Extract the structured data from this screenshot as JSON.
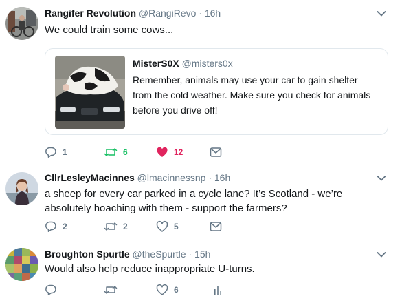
{
  "tweets": [
    {
      "name": "Rangifer Revolution",
      "handle": "@RangiRevo",
      "dot": "·",
      "time": "16h",
      "text": "We could train some cows...",
      "quoted": {
        "name": "MisterS0X",
        "handle": "@misters0x",
        "text": "Remember, animals may use your car to gain shelter from the cold weather. Make sure you check for animals before you drive off!"
      },
      "actions": {
        "replies": "1",
        "retweets": "6",
        "likes": "12"
      }
    },
    {
      "name": "CllrLesleyMacinnes",
      "handle": "@lmacinnessnp",
      "dot": "·",
      "time": "16h",
      "text": "a sheep for every car parked in a cycle lane? It’s Scotland - we’re absolutely hoaching with them - support the farmers?",
      "actions": {
        "replies": "2",
        "retweets": "2",
        "likes": "5"
      }
    },
    {
      "name": "Broughton Spurtle",
      "handle": "@theSpurtle",
      "dot": "·",
      "time": "15h",
      "text": "Would also help reduce inappropriate U-turns.",
      "actions": {
        "replies": "",
        "retweets": "",
        "likes": "6"
      }
    }
  ],
  "colors": {
    "text": "#14171a",
    "muted": "#657786",
    "retweet_active": "#17bf63",
    "like_active": "#e0245e",
    "divider": "#e6ecf0"
  },
  "icons": [
    "reply-icon",
    "retweet-icon",
    "like-icon",
    "direct-message-icon",
    "analytics-icon",
    "chevron-down-icon"
  ]
}
